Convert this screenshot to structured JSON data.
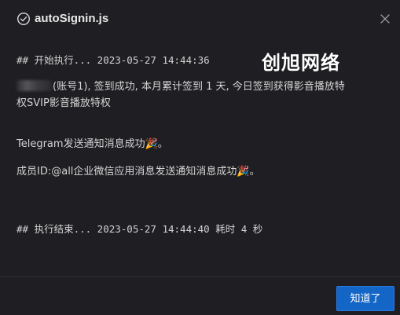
{
  "dialog": {
    "title": "autoSignin.js",
    "status_icon": "check-circle-icon",
    "close_icon": "close-icon"
  },
  "log": {
    "start_line": "## 开始执行... 2023-05-27 14:44:36",
    "signin_line_1": "(账号1), 签到成功, 本月累计签到 1 天, 今日签到获得影音播放特",
    "signin_line_2": "权SVIP影音播放特权",
    "telegram_line": "Telegram发送通知消息成功🎉。",
    "wecom_line": "成员ID:@all企业微信应用消息发送通知消息成功🎉。",
    "end_line": "## 执行结束... 2023-05-27 14:44:40  耗时 4 秒"
  },
  "watermark": {
    "text": "创旭网络"
  },
  "footer": {
    "ok_label": "知道了"
  },
  "colors": {
    "background": "#1f1f23",
    "primary_button": "#1466c6",
    "text": "#d4d4d4"
  }
}
